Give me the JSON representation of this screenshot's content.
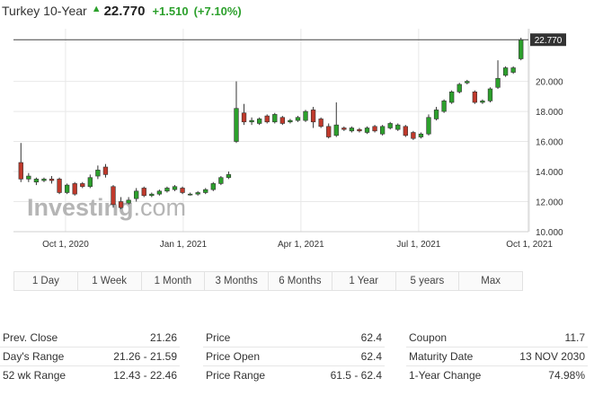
{
  "header": {
    "title": "Turkey 10-Year",
    "price": "22.770",
    "change": "+1.510",
    "change_pct": "(+7.10%)"
  },
  "colors": {
    "up": "#2ca02c",
    "down": "#c0392b",
    "grid": "#e8e8e8",
    "label_bg": "#333333"
  },
  "chart_data": {
    "type": "candlestick",
    "title": "",
    "xlabel": "",
    "ylabel": "",
    "x_ticks": [
      "Oct 1, 2020",
      "Jan 1, 2021",
      "Apr 1, 2021",
      "Jul 1, 2021",
      "Oct 1, 2021"
    ],
    "y_ticks": [
      "10.000",
      "12.000",
      "14.000",
      "16.000",
      "18.000",
      "20.000",
      "22.770"
    ],
    "ylim": [
      10,
      23.5
    ],
    "last_value": "22.770",
    "grid": true,
    "watermark": "Investing.com",
    "candles": [
      {
        "o": 14.6,
        "c": 13.5,
        "h": 15.9,
        "l": 13.3
      },
      {
        "o": 13.5,
        "c": 13.7,
        "h": 13.9,
        "l": 13.3
      },
      {
        "o": 13.3,
        "c": 13.5,
        "h": 13.6,
        "l": 13.1
      },
      {
        "o": 13.4,
        "c": 13.5,
        "h": 13.6,
        "l": 13.3
      },
      {
        "o": 13.5,
        "c": 13.4,
        "h": 13.7,
        "l": 13.2
      },
      {
        "o": 13.5,
        "c": 12.6,
        "h": 13.6,
        "l": 12.5
      },
      {
        "o": 12.6,
        "c": 13.1,
        "h": 13.2,
        "l": 12.5
      },
      {
        "o": 13.2,
        "c": 12.5,
        "h": 13.3,
        "l": 12.4
      },
      {
        "o": 13.2,
        "c": 13.0,
        "h": 13.3,
        "l": 12.9
      },
      {
        "o": 13.0,
        "c": 13.6,
        "h": 13.8,
        "l": 12.9
      },
      {
        "o": 13.7,
        "c": 14.1,
        "h": 14.4,
        "l": 13.5
      },
      {
        "o": 14.3,
        "c": 13.8,
        "h": 14.5,
        "l": 13.6
      },
      {
        "o": 13.0,
        "c": 11.8,
        "h": 13.1,
        "l": 11.6
      },
      {
        "o": 12.0,
        "c": 11.6,
        "h": 12.3,
        "l": 11.5
      },
      {
        "o": 11.9,
        "c": 12.1,
        "h": 12.3,
        "l": 11.8
      },
      {
        "o": 12.2,
        "c": 12.7,
        "h": 12.9,
        "l": 12.0
      },
      {
        "o": 12.9,
        "c": 12.4,
        "h": 13.0,
        "l": 12.3
      },
      {
        "o": 12.4,
        "c": 12.5,
        "h": 12.6,
        "l": 12.3
      },
      {
        "o": 12.5,
        "c": 12.7,
        "h": 12.8,
        "l": 12.4
      },
      {
        "o": 12.7,
        "c": 12.9,
        "h": 13.0,
        "l": 12.6
      },
      {
        "o": 12.8,
        "c": 13.0,
        "h": 13.1,
        "l": 12.7
      },
      {
        "o": 12.9,
        "c": 12.6,
        "h": 13.0,
        "l": 12.5
      },
      {
        "o": 12.5,
        "c": 12.5,
        "h": 12.6,
        "l": 12.4
      },
      {
        "o": 12.5,
        "c": 12.6,
        "h": 12.7,
        "l": 12.4
      },
      {
        "o": 12.6,
        "c": 12.8,
        "h": 12.9,
        "l": 12.5
      },
      {
        "o": 12.8,
        "c": 13.2,
        "h": 13.3,
        "l": 12.7
      },
      {
        "o": 13.2,
        "c": 13.6,
        "h": 13.7,
        "l": 13.1
      },
      {
        "o": 13.6,
        "c": 13.8,
        "h": 14.0,
        "l": 13.5
      },
      {
        "o": 16.0,
        "c": 18.2,
        "h": 20.0,
        "l": 15.9
      },
      {
        "o": 17.9,
        "c": 17.3,
        "h": 18.5,
        "l": 17.1
      },
      {
        "o": 17.3,
        "c": 17.4,
        "h": 17.6,
        "l": 17.1
      },
      {
        "o": 17.2,
        "c": 17.5,
        "h": 17.6,
        "l": 17.1
      },
      {
        "o": 17.7,
        "c": 17.3,
        "h": 17.8,
        "l": 17.2
      },
      {
        "o": 17.3,
        "c": 17.8,
        "h": 17.9,
        "l": 17.2
      },
      {
        "o": 17.6,
        "c": 17.2,
        "h": 17.7,
        "l": 17.1
      },
      {
        "o": 17.3,
        "c": 17.4,
        "h": 17.5,
        "l": 17.2
      },
      {
        "o": 17.4,
        "c": 17.6,
        "h": 17.7,
        "l": 17.3
      },
      {
        "o": 17.4,
        "c": 18.0,
        "h": 18.1,
        "l": 17.3
      },
      {
        "o": 18.1,
        "c": 17.3,
        "h": 18.3,
        "l": 16.9
      },
      {
        "o": 17.5,
        "c": 17.0,
        "h": 17.6,
        "l": 16.9
      },
      {
        "o": 17.0,
        "c": 16.3,
        "h": 17.2,
        "l": 16.2
      },
      {
        "o": 16.4,
        "c": 17.1,
        "h": 18.6,
        "l": 16.3
      },
      {
        "o": 16.9,
        "c": 16.8,
        "h": 17.0,
        "l": 16.7
      },
      {
        "o": 16.7,
        "c": 16.9,
        "h": 17.0,
        "l": 16.6
      },
      {
        "o": 16.8,
        "c": 16.7,
        "h": 16.9,
        "l": 16.6
      },
      {
        "o": 16.6,
        "c": 16.9,
        "h": 17.0,
        "l": 16.5
      },
      {
        "o": 17.0,
        "c": 16.7,
        "h": 17.1,
        "l": 16.6
      },
      {
        "o": 16.5,
        "c": 17.0,
        "h": 17.1,
        "l": 16.4
      },
      {
        "o": 16.9,
        "c": 17.2,
        "h": 17.3,
        "l": 16.8
      },
      {
        "o": 16.8,
        "c": 17.1,
        "h": 17.2,
        "l": 16.7
      },
      {
        "o": 17.0,
        "c": 16.4,
        "h": 17.1,
        "l": 16.3
      },
      {
        "o": 16.6,
        "c": 16.2,
        "h": 16.7,
        "l": 16.1
      },
      {
        "o": 16.3,
        "c": 16.5,
        "h": 16.6,
        "l": 16.2
      },
      {
        "o": 16.5,
        "c": 17.6,
        "h": 17.8,
        "l": 16.4
      },
      {
        "o": 17.5,
        "c": 18.1,
        "h": 18.3,
        "l": 17.4
      },
      {
        "o": 18.0,
        "c": 18.7,
        "h": 18.8,
        "l": 17.9
      },
      {
        "o": 18.6,
        "c": 19.3,
        "h": 19.4,
        "l": 18.5
      },
      {
        "o": 19.3,
        "c": 19.8,
        "h": 19.9,
        "l": 19.2
      },
      {
        "o": 19.9,
        "c": 20.0,
        "h": 20.1,
        "l": 19.8
      },
      {
        "o": 19.3,
        "c": 18.6,
        "h": 19.4,
        "l": 18.5
      },
      {
        "o": 18.6,
        "c": 18.7,
        "h": 18.8,
        "l": 18.5
      },
      {
        "o": 18.7,
        "c": 19.5,
        "h": 19.6,
        "l": 18.6
      },
      {
        "o": 19.6,
        "c": 20.2,
        "h": 21.4,
        "l": 19.5
      },
      {
        "o": 20.4,
        "c": 20.9,
        "h": 21.0,
        "l": 20.3
      },
      {
        "o": 20.6,
        "c": 20.9,
        "h": 21.0,
        "l": 20.5
      },
      {
        "o": 21.5,
        "c": 22.77,
        "h": 22.9,
        "l": 21.4
      }
    ]
  },
  "tabs": [
    "1 Day",
    "1 Week",
    "1 Month",
    "3 Months",
    "6 Months",
    "1 Year",
    "5 years",
    "Max"
  ],
  "stats": {
    "col1": [
      {
        "label": "Prev. Close",
        "value": "21.26"
      },
      {
        "label": "Day's Range",
        "value": "21.26 - 21.59"
      },
      {
        "label": "52 wk Range",
        "value": "12.43 - 22.46"
      }
    ],
    "col2": [
      {
        "label": "Price",
        "value": "62.4"
      },
      {
        "label": "Price Open",
        "value": "62.4"
      },
      {
        "label": "Price Range",
        "value": "61.5 - 62.4"
      }
    ],
    "col3": [
      {
        "label": "Coupon",
        "value": "11.7"
      },
      {
        "label": "Maturity Date",
        "value": "13 NOV 2030"
      },
      {
        "label": "1-Year Change",
        "value": "74.98%"
      }
    ]
  }
}
